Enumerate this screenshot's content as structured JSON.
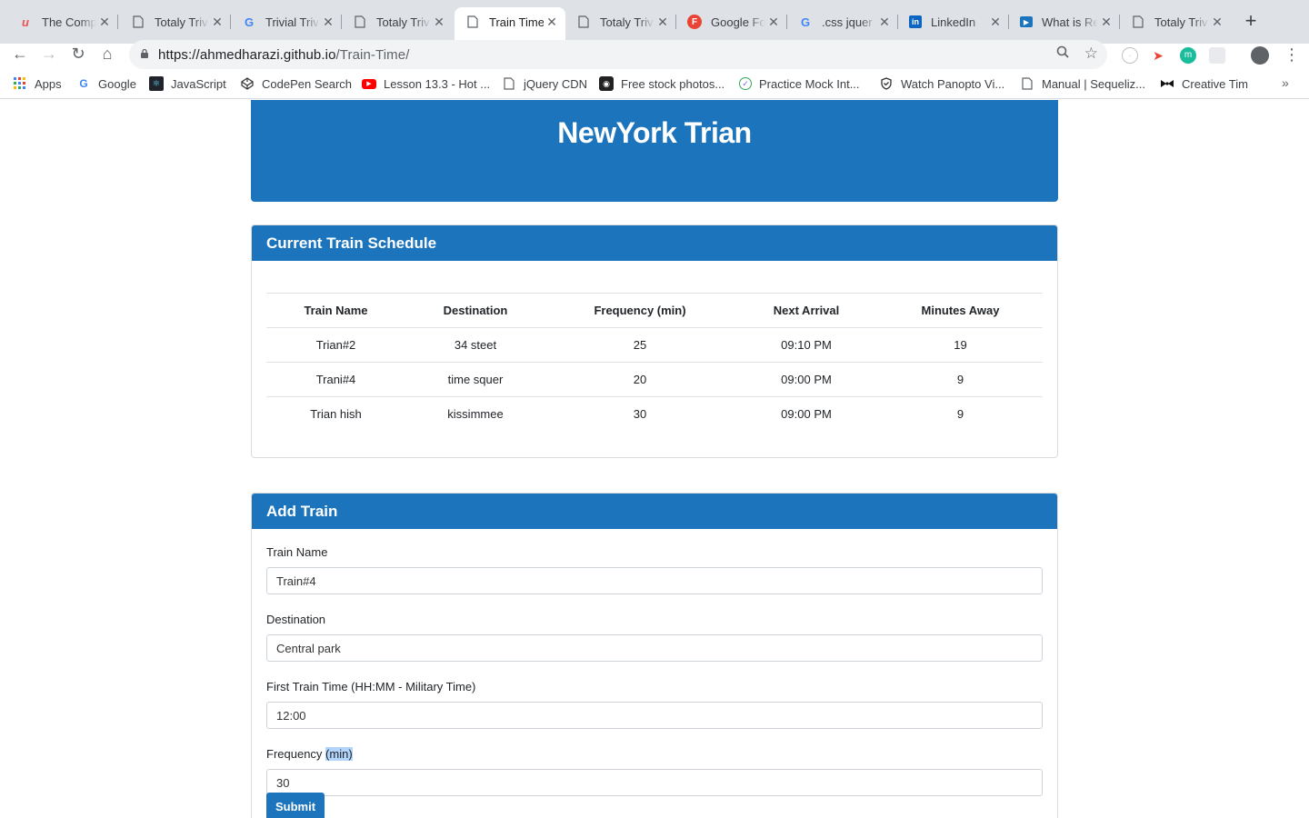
{
  "browser": {
    "tabs": [
      {
        "title": "The Comp",
        "icon": "udemy-icon",
        "active": false
      },
      {
        "title": "Totaly Triv",
        "icon": "page-icon",
        "active": false
      },
      {
        "title": "Trivial Triv",
        "icon": "google-icon",
        "active": false
      },
      {
        "title": "Totaly Triv",
        "icon": "page-icon",
        "active": false
      },
      {
        "title": "Train Time",
        "icon": "page-icon",
        "active": true
      },
      {
        "title": "Totaly Triv",
        "icon": "page-icon",
        "active": false
      },
      {
        "title": "Google Fo",
        "icon": "fonts-icon",
        "active": false
      },
      {
        "title": ".css jquer",
        "icon": "google-icon",
        "active": false
      },
      {
        "title": "LinkedIn",
        "icon": "linkedin-icon",
        "active": false
      },
      {
        "title": "What is Re",
        "icon": "video-icon",
        "active": false
      },
      {
        "title": "Totaly Triv",
        "icon": "page-icon",
        "active": false
      }
    ],
    "url_host": "https://ahmedharazi.github.io",
    "url_path": "/Train-Time/",
    "bookmarks": [
      {
        "label": "Apps",
        "icon": "apps-grid-icon"
      },
      {
        "label": "Google",
        "icon": "google-icon"
      },
      {
        "label": "JavaScript",
        "icon": "react-icon"
      },
      {
        "label": "CodePen Search",
        "icon": "codepen-icon"
      },
      {
        "label": "Lesson 13.3 - Hot ...",
        "icon": "youtube-icon"
      },
      {
        "label": "jQuery CDN",
        "icon": "page-icon"
      },
      {
        "label": "Free stock photos...",
        "icon": "camera-icon"
      },
      {
        "label": "Practice Mock Int...",
        "icon": "check-icon"
      },
      {
        "label": "Watch Panopto Vi...",
        "icon": "shield-icon"
      },
      {
        "label": "Manual | Sequeliz...",
        "icon": "page-icon"
      },
      {
        "label": "Creative Tim",
        "icon": "bowtie-icon"
      }
    ]
  },
  "page": {
    "title": "NewYork Trian",
    "schedule": {
      "heading": "Current Train Schedule",
      "columns": [
        "Train Name",
        "Destination",
        "Frequency (min)",
        "Next Arrival",
        "Minutes Away"
      ],
      "rows": [
        [
          "Trian#2",
          "34 steet",
          "25",
          "09:10 PM",
          "19"
        ],
        [
          "Trani#4",
          "time squer",
          "20",
          "09:00 PM",
          "9"
        ],
        [
          "Trian hish",
          "kissimmee",
          "30",
          "09:00 PM",
          "9"
        ]
      ]
    },
    "add_train": {
      "heading": "Add Train",
      "train_name_label": "Train Name",
      "train_name_value": "Train#4",
      "destination_label": "Destination",
      "destination_value": "Central park",
      "first_time_label": "First Train Time (HH:MM - Military Time)",
      "first_time_value": "12:00",
      "frequency_label_a": "Frequency ",
      "frequency_label_b": "(min)",
      "frequency_value": "30",
      "submit_label": "Submit"
    }
  },
  "colors": {
    "primary": "#1c75bc",
    "selection": "#b3d4fc"
  }
}
